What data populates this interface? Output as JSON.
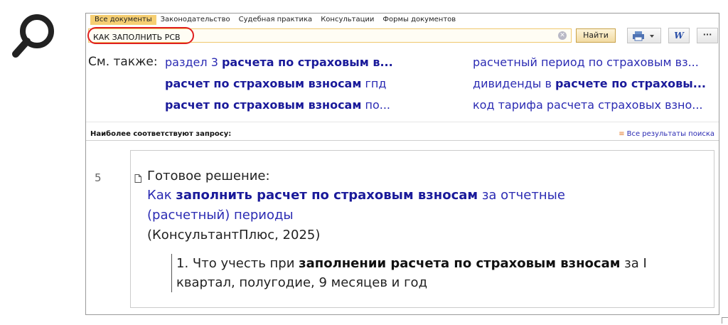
{
  "tabs": [
    "Все документы",
    "Законодательство",
    "Судебная практика",
    "Консультации",
    "Формы документов"
  ],
  "search": {
    "value": "КАК ЗАПОЛНИТЬ РСВ"
  },
  "find_label": "Найти",
  "word_label": "W",
  "more_label": "···",
  "see_also": {
    "label": "См. также:",
    "left": [
      {
        "pre": "раздел 3 ",
        "bold": "расчета по страховым в...",
        "post": ""
      },
      {
        "pre": "",
        "bold": "расчет по страховым взносам",
        "post": " гпд"
      },
      {
        "pre": "",
        "bold": "расчет по страховым взносам",
        "post": " по..."
      }
    ],
    "right": [
      {
        "pre": "расчетный период по страховым вз...",
        "bold": "",
        "post": ""
      },
      {
        "pre": "дивиденды в ",
        "bold": "расчете по страховы...",
        "post": ""
      },
      {
        "pre": "код тарифа расчета страховых взно...",
        "bold": "",
        "post": ""
      }
    ]
  },
  "best_match_label": "Наиболее соответствуют запросу:",
  "all_results_label": "Все результаты поиска",
  "result": {
    "number": "5",
    "type": "Готовое решение:",
    "title_pre": "Как ",
    "title_bold": "заполнить расчет по страховым взносам",
    "title_post": " за отчетные",
    "title_line2": "(расчетный) периоды",
    "source": "(КонсультантПлюс, 2025)",
    "excerpt_pre": "1. Что учесть при ",
    "excerpt_bold": "заполнении расчета по страховым взносам",
    "excerpt_post": " за I",
    "excerpt_line2": "квартал, полугодие, 9 месяцев и год"
  }
}
